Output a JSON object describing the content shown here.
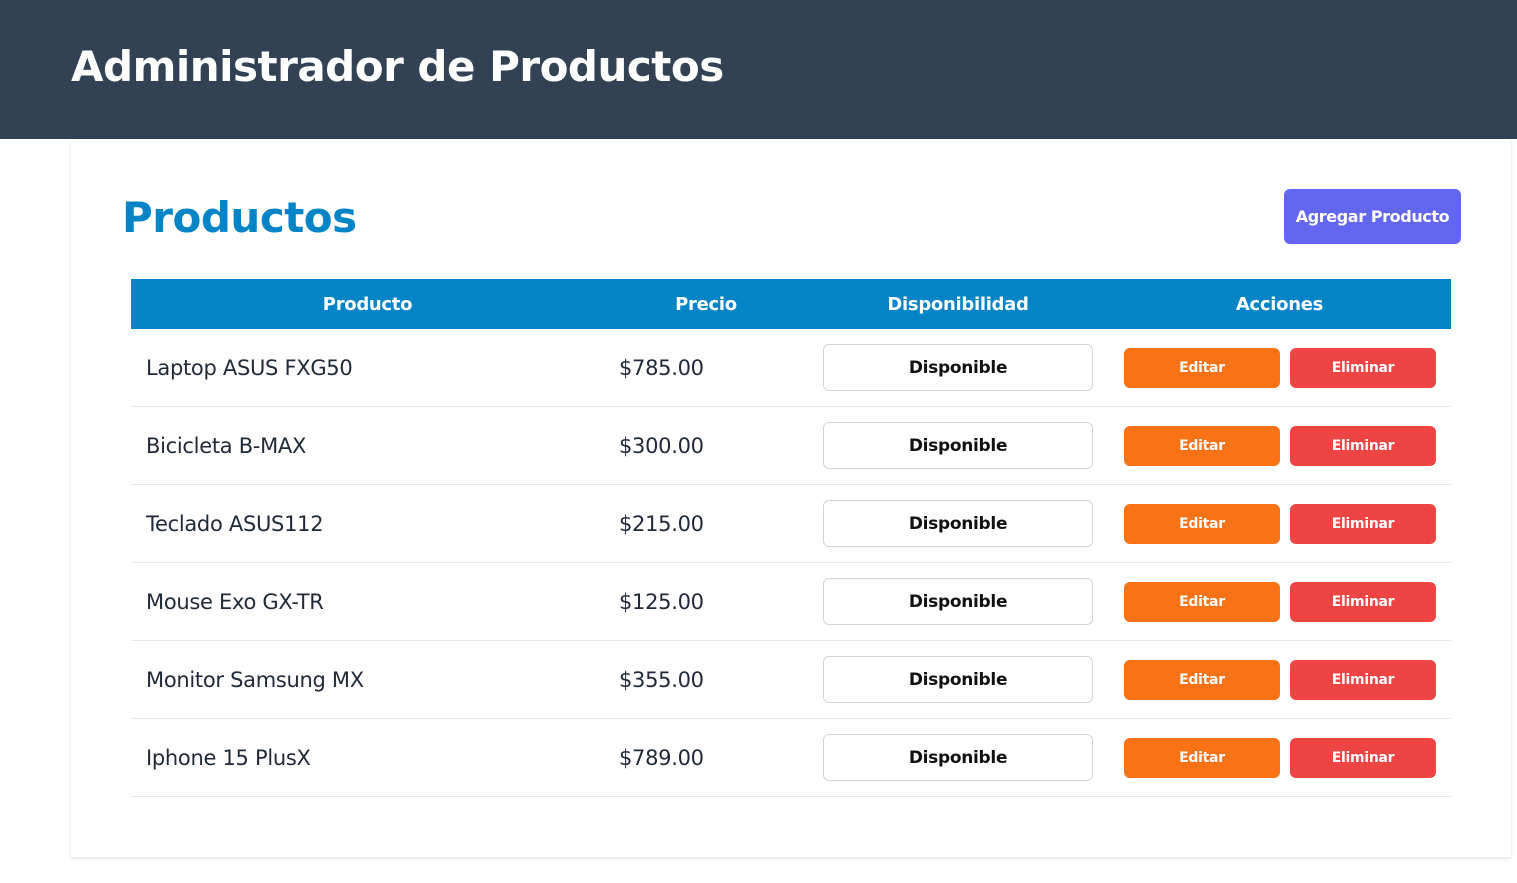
{
  "header": {
    "title": "Administrador de Productos",
    "background": "#334155"
  },
  "main": {
    "title": "Productos",
    "title_color": "#0284c7",
    "add_button_label": "Agregar Producto",
    "add_button_color": "#6366f1"
  },
  "table": {
    "header_color": "#0284c7",
    "columns": [
      "Producto",
      "Precio",
      "Disponibilidad",
      "Acciones"
    ],
    "rows": [
      {
        "name": "Laptop ASUS FXG50",
        "price": "$785.00",
        "status": "Disponible",
        "edit": "Editar",
        "delete": "Eliminar"
      },
      {
        "name": "Bicicleta B-MAX",
        "price": "$300.00",
        "status": "Disponible",
        "edit": "Editar",
        "delete": "Eliminar"
      },
      {
        "name": "Teclado ASUS112",
        "price": "$215.00",
        "status": "Disponible",
        "edit": "Editar",
        "delete": "Eliminar"
      },
      {
        "name": "Mouse Exo GX-TR",
        "price": "$125.00",
        "status": "Disponible",
        "edit": "Editar",
        "delete": "Eliminar"
      },
      {
        "name": "Monitor Samsung MX",
        "price": "$355.00",
        "status": "Disponible",
        "edit": "Editar",
        "delete": "Eliminar"
      },
      {
        "name": "Iphone 15 PlusX",
        "price": "$789.00",
        "status": "Disponible",
        "edit": "Editar",
        "delete": "Eliminar"
      }
    ],
    "edit_color": "#f97316",
    "delete_color": "#ef4444"
  }
}
